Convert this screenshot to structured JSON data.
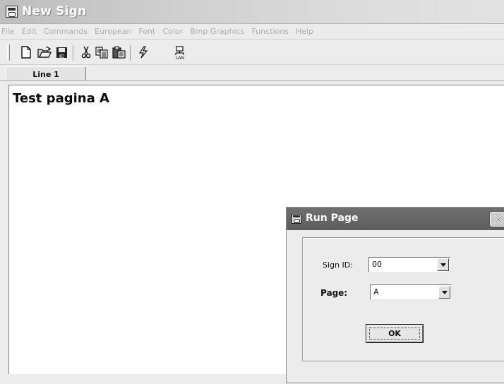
{
  "window": {
    "title": "New Sign",
    "icon": "app-icon"
  },
  "menubar": {
    "items": [
      "File",
      "Edit",
      "Commands",
      "European",
      "Font",
      "Color",
      "Bmp Graphics",
      "Functions",
      "Help"
    ]
  },
  "toolbar": {
    "buttons": [
      "new-icon",
      "open-icon",
      "save-icon",
      "cut-icon",
      "copy-icon",
      "paste-icon",
      "lightning-icon",
      "lan-icon"
    ],
    "lan_label": "LAN"
  },
  "tabs": {
    "active": "Line 1"
  },
  "editor": {
    "text": "Test pagina A"
  },
  "dialog": {
    "title": "Run Page",
    "sign_id_label": "Sign ID:",
    "sign_id_value": "00",
    "page_label": "Page:",
    "page_value": "A",
    "ok_label": "OK",
    "close_icon": "close-icon"
  }
}
